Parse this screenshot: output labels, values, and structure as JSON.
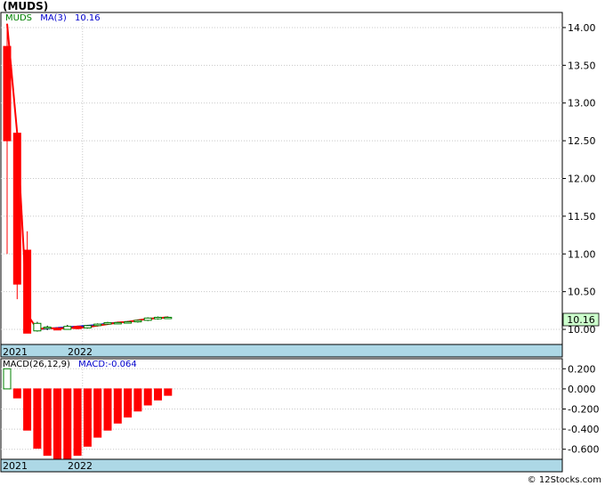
{
  "title": "(MUDS)",
  "footer": "© 12Stocks.com",
  "price_panel": {
    "legend": {
      "ticker": "MUDS",
      "ma_label": "MA(3)",
      "ma_value": "10.16"
    },
    "last_price_label": "10.16",
    "colors": {
      "ticker": "#008000",
      "ma": "#0000cc",
      "bull": "#008000",
      "bear": "#ff0000",
      "ma_line": "#ff0000",
      "trend": "#0000cc",
      "last_bg": "#ccffcc"
    }
  },
  "macd_panel": {
    "legend": {
      "name": "MACD(26,12,9)",
      "value_label": "MACD:-0.064"
    },
    "colors": {
      "name": "#000000",
      "value": "#0000cc",
      "pos": "#008000",
      "neg": "#ff0000"
    }
  },
  "x_axis": {
    "labels": [
      "2021",
      "2022"
    ],
    "band_color": "#add8e6"
  },
  "chart_data": [
    {
      "type": "candlestick",
      "name": "price",
      "ylim": [
        9.8,
        14.2
      ],
      "yticks": [
        10.0,
        10.5,
        11.0,
        11.5,
        12.0,
        12.5,
        13.0,
        13.5,
        14.0
      ],
      "ytick_labels": [
        "10.00",
        "10.50",
        "11.00",
        "11.50",
        "12.00",
        "12.50",
        "13.00",
        "13.50",
        "14.00"
      ],
      "bars": [
        {
          "o": 13.75,
          "h": 14.05,
          "l": 11.0,
          "c": 12.5
        },
        {
          "o": 12.6,
          "h": 12.6,
          "l": 10.4,
          "c": 10.6
        },
        {
          "o": 11.05,
          "h": 11.3,
          "l": 9.95,
          "c": 9.95
        },
        {
          "o": 9.98,
          "h": 10.1,
          "l": 9.97,
          "c": 10.08
        },
        {
          "o": 10.02,
          "h": 10.05,
          "l": 9.99,
          "c": 10.03
        },
        {
          "o": 10.01,
          "h": 10.03,
          "l": 9.99,
          "c": 10.0
        },
        {
          "o": 10.0,
          "h": 10.06,
          "l": 10.0,
          "c": 10.04
        },
        {
          "o": 10.04,
          "h": 10.05,
          "l": 10.0,
          "c": 10.01
        },
        {
          "o": 10.02,
          "h": 10.06,
          "l": 10.01,
          "c": 10.05
        },
        {
          "o": 10.05,
          "h": 10.08,
          "l": 10.04,
          "c": 10.07
        },
        {
          "o": 10.07,
          "h": 10.1,
          "l": 10.06,
          "c": 10.09
        },
        {
          "o": 10.08,
          "h": 10.1,
          "l": 10.07,
          "c": 10.09
        },
        {
          "o": 10.09,
          "h": 10.11,
          "l": 10.08,
          "c": 10.1
        },
        {
          "o": 10.1,
          "h": 10.13,
          "l": 10.09,
          "c": 10.12
        },
        {
          "o": 10.12,
          "h": 10.16,
          "l": 10.11,
          "c": 10.15
        },
        {
          "o": 10.14,
          "h": 10.17,
          "l": 10.13,
          "c": 10.16
        },
        {
          "o": 10.15,
          "h": 10.17,
          "l": 10.14,
          "c": 10.16
        }
      ],
      "ma": [
        14.05,
        12.6,
        10.2,
        10.0,
        10.02,
        10.01,
        10.02,
        10.02,
        10.03,
        10.05,
        10.07,
        10.09,
        10.1,
        10.12,
        10.14,
        10.15,
        10.16
      ],
      "trend": [
        null,
        null,
        null,
        10.0,
        10.01,
        10.02,
        10.03,
        10.04,
        10.05,
        10.06,
        10.08,
        10.09,
        10.1,
        10.12,
        10.14,
        10.15,
        10.16
      ]
    },
    {
      "type": "bar",
      "name": "MACD",
      "ylim": [
        -0.7,
        0.3
      ],
      "yticks": [
        0.2,
        0.0,
        -0.2,
        -0.4,
        -0.6
      ],
      "ytick_labels": [
        "0.200",
        "0.000",
        "-0.200",
        "-0.400",
        "-0.600"
      ],
      "values": [
        0.2,
        -0.09,
        -0.41,
        -0.59,
        -0.66,
        -0.71,
        -0.71,
        -0.66,
        -0.57,
        -0.48,
        -0.41,
        -0.34,
        -0.28,
        -0.22,
        -0.16,
        -0.11,
        -0.064
      ]
    }
  ]
}
